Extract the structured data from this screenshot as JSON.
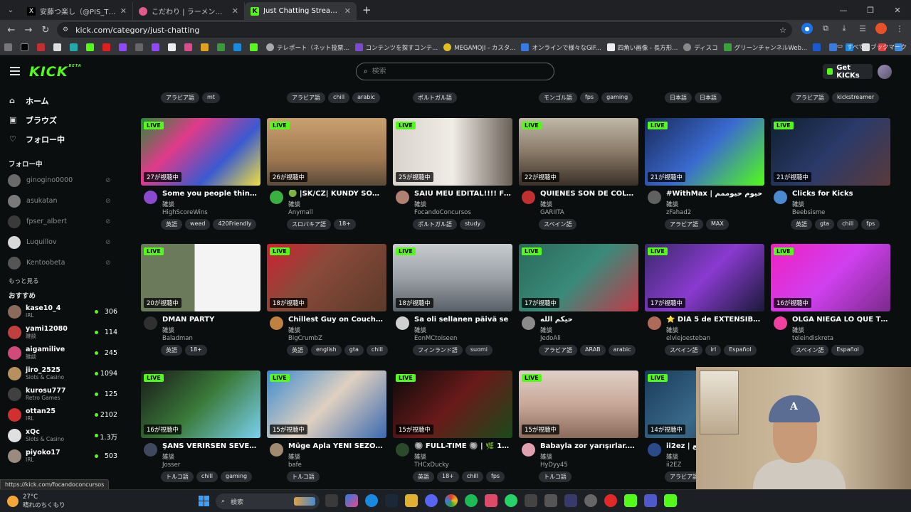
{
  "browser": {
    "tabs": [
      {
        "title": "安藤つ楽し（@PIS_TSUYOSHI）",
        "favicon": "x-icon",
        "active": false
      },
      {
        "title": "こだわり | ラーメン豚山",
        "favicon": "pig-icon",
        "active": false
      },
      {
        "title": "Just Chatting Streaming - Live",
        "favicon": "kick-icon",
        "active": true
      }
    ],
    "url": "kick.com/category/just-chatting",
    "bookmarks": [
      "テレポート（ネット投票...",
      "コンテンツを探すコンテ...",
      "MEGAMOJI - カスタ...",
      "オンラインで様々なGIF...",
      "四角い画像 - 長方形...",
      "ディスコ",
      "グリーンチャンネルWeb..."
    ],
    "bookmarks_all": "すべてのブックマーク"
  },
  "header": {
    "logo": "KICK",
    "logo_beta": "BETA",
    "search_placeholder": "検索",
    "get_kicks": "Get KICKs"
  },
  "sidebar": {
    "nav": [
      {
        "label": "ホーム",
        "icon": "home-icon"
      },
      {
        "label": "ブラウズ",
        "icon": "browse-icon"
      },
      {
        "label": "フォロー中",
        "icon": "heart-icon"
      }
    ],
    "following_heading": "フォロー中",
    "following": [
      {
        "name": "ginogino0000",
        "color": "#6a6a6a"
      },
      {
        "name": "asukatan",
        "color": "#7a7a7a"
      },
      {
        "name": "fpser_albert",
        "color": "#3a3a3a"
      },
      {
        "name": "Luquillov",
        "color": "#d8d8d8"
      },
      {
        "name": "Kentoobeta",
        "color": "#555"
      }
    ],
    "more_label": "もっと見る",
    "recommended_heading": "おすすめ",
    "recommended": [
      {
        "name": "kase10_4",
        "category": "IRL",
        "viewers": "306",
        "color": "#8a6a5a"
      },
      {
        "name": "yami12080",
        "category": "雑談",
        "viewers": "114",
        "color": "#c04040"
      },
      {
        "name": "aigamilive",
        "category": "雑談",
        "viewers": "245",
        "color": "#d04a7a"
      },
      {
        "name": "jiro_2525",
        "category": "Slots & Casino",
        "viewers": "1094",
        "color": "#b89060"
      },
      {
        "name": "kurosu777",
        "category": "Retro Games",
        "viewers": "125",
        "color": "#404040"
      },
      {
        "name": "ottan25",
        "category": "IRL",
        "viewers": "2102",
        "color": "#d03030"
      },
      {
        "name": "xQc",
        "category": "Slots & Casino",
        "viewers": "1.3万",
        "color": "#e0e0e0"
      },
      {
        "name": "piyoko17",
        "category": "IRL",
        "viewers": "503",
        "color": "#9a8a80"
      }
    ]
  },
  "partial_row": [
    {
      "tags": [
        "アラビア語",
        "mt"
      ]
    },
    {
      "tags": [
        "アラビア語",
        "chill",
        "arabic"
      ]
    },
    {
      "tags": [
        "ポルトガル語"
      ]
    },
    {
      "tags": [
        "モンゴル語",
        "fps",
        "gaming"
      ]
    },
    {
      "tags": [
        "日本語",
        "日本語"
      ]
    },
    {
      "tags": [
        "アラビア語",
        "kickstreamer"
      ]
    }
  ],
  "streams": [
    {
      "live": "LIVE",
      "viewers": "27が視聴中",
      "title": "Some you people think I'...",
      "category": "雑談",
      "channel": "HighScoreWins",
      "tags": [
        "英語",
        "weed",
        "420Friendly"
      ],
      "thumb": "linear-gradient(135deg,#2a8a3a,#e03a8a,#3a5ad0,#f0e040)",
      "avatar": "#8a4ad0"
    },
    {
      "live": "LIVE",
      "viewers": "26が視聴中",
      "title": "🟢 |SK/CZ| KUNDY SOM ...",
      "category": "雑談",
      "channel": "Anymall",
      "tags": [
        "スロバキア語",
        "18+"
      ],
      "thumb": "linear-gradient(180deg,#c8a070,#a07850 60%,#5a4a3a)",
      "avatar": "#3ab040"
    },
    {
      "live": "LIVE",
      "viewers": "25が視聴中",
      "title": "SAIU MEU EDITAL!!!! Foco...",
      "category": "雑談",
      "channel": "FocandoConcursos",
      "tags": [
        "ポルトガル語",
        "study"
      ],
      "thumb": "linear-gradient(90deg,#d8d4cc,#f0ece6 50%,#6a6058)",
      "avatar": "#b08070"
    },
    {
      "live": "LIVE",
      "viewers": "22が視聴中",
      "title": "QUIENES SON DE COLOM...",
      "category": "雑談",
      "channel": "GARIITA",
      "tags": [
        "スペイン語"
      ],
      "thumb": "linear-gradient(180deg,#c0b8a8,#8a7a68 50%,#3a3028)",
      "avatar": "#c03030"
    },
    {
      "live": "LIVE",
      "viewers": "21が視聴中",
      "title": "#WithMax | حيوم حيوممم",
      "category": "雑談",
      "channel": "zFahad2",
      "tags": [
        "アラビア語",
        "MAX"
      ],
      "thumb": "linear-gradient(135deg,#1a2a5a,#3a6ad0 50%,#53fc18)",
      "avatar": "#606060"
    },
    {
      "live": "LIVE",
      "viewers": "21が視聴中",
      "title": "Clicks for Kicks",
      "category": "雑談",
      "channel": "Beebsisme",
      "tags": [
        "英語",
        "gta",
        "chill",
        "fps"
      ],
      "thumb": "linear-gradient(135deg,#102030,#2a3a6a 50%,#5a3a3a)",
      "avatar": "#4a8ad0"
    },
    {
      "live": "LIVE",
      "viewers": "20が視聴中",
      "title": "DMAN PARTY",
      "category": "雑談",
      "channel": "Baladman",
      "tags": [
        "英語",
        "18+"
      ],
      "thumb": "linear-gradient(90deg,#6a7a5a 45%,#f4f4f4 45%)",
      "avatar": "#303030"
    },
    {
      "live": "LIVE",
      "viewers": "18が視聴中",
      "title": "Chillest Guy on Couch ! V...",
      "category": "雑談",
      "channel": "BigCrumbZ",
      "tags": [
        "英語",
        "english",
        "gta",
        "chill"
      ],
      "thumb": "linear-gradient(135deg,#d02030,#8a4a3a 40%,#5a3a2a)",
      "avatar": "#c08040"
    },
    {
      "live": "LIVE",
      "viewers": "18が視聴中",
      "title": "Sa oli sellanen päivä se",
      "category": "雑談",
      "channel": "EonMCtoiseen",
      "tags": [
        "フィンランド語",
        "suomi"
      ],
      "thumb": "linear-gradient(180deg,#c8ccd0,#9aa0a6 50%,#5a6068)",
      "avatar": "#d0d0d0"
    },
    {
      "live": "LIVE",
      "viewers": "17が視聴中",
      "title": "حيكم الله",
      "category": "雑談",
      "channel": "JedoAli",
      "tags": [
        "アラビア語",
        "ARAB",
        "arabic"
      ],
      "thumb": "linear-gradient(135deg,#2a6a5a,#3a8a7a 50%,#c03a4a)",
      "avatar": "#8a8a8a"
    },
    {
      "live": "LIVE",
      "viewers": "17が視聴中",
      "title": "⭐ DÍA 5 de EXTENSIBLE ...",
      "category": "雑談",
      "channel": "elviejoesteban",
      "tags": [
        "スペイン語",
        "irl",
        "Español"
      ],
      "thumb": "linear-gradient(135deg,#3a2a6a,#8a3ad0 50%,#1a1a3a)",
      "avatar": "#b06a5a"
    },
    {
      "live": "LIVE",
      "viewers": "16が視聴中",
      "title": "OLGA NIEGA LO QUE TOD...",
      "category": "雑談",
      "channel": "teleindiskreta",
      "tags": [
        "スペイン語",
        "Español"
      ],
      "thumb": "linear-gradient(135deg,#f020c0,#d040f0 50%,#7a2a8a)",
      "avatar": "#f040a0"
    },
    {
      "live": "LIVE",
      "viewers": "16が視聴中",
      "title": "ŞANS VERİRSEN SEVERSİ...",
      "category": "雑談",
      "channel": "Josser",
      "tags": [
        "トルコ語",
        "chill",
        "gaming"
      ],
      "thumb": "linear-gradient(135deg,#1a1a1a,#3a7a3a 50%,#7ad0f0)",
      "avatar": "#404860"
    },
    {
      "live": "LIVE",
      "viewers": "15が視聴中",
      "title": "Müge Apla YENİ SEZON Y...",
      "category": "雑談",
      "channel": "bafe",
      "tags": [
        "トルコ語"
      ],
      "thumb": "linear-gradient(135deg,#3a8ad0,#e0d0c0 50%,#3a6ab0)",
      "avatar": "#a08a70"
    },
    {
      "live": "LIVE",
      "viewers": "15が視聴中",
      "title": "🔘 FULL-TIME 🔘 | 🌿 18+ ...",
      "category": "雑談",
      "channel": "THCxDucky",
      "tags": [
        "英語",
        "18+",
        "chill",
        "fps"
      ],
      "thumb": "linear-gradient(135deg,#0a0a0a,#6a1a1a 50%,#1a4a1a)",
      "avatar": "#2a4a2a"
    },
    {
      "live": "LIVE",
      "viewers": "15が視聴中",
      "title": "Babayla zor yarışırlar. ! Ba...",
      "category": "雑談",
      "channel": "HyDyy45",
      "tags": [
        "トルコ語"
      ],
      "thumb": "linear-gradient(180deg,#e0d0c8,#c8a898 50%,#8a6a5a)",
      "avatar": "#e0a0b0"
    },
    {
      "live": "LIVE",
      "viewers": "14が視聴中",
      "title": "ii2ez | ربيع",
      "category": "雑談",
      "channel": "ii2EZ",
      "tags": [
        "アラビア語"
      ],
      "thumb": "linear-gradient(135deg,#1a3a5a,#3a6a8a 50%,#1a2a3a)",
      "avatar": "#2a4a8a"
    }
  ],
  "status_url": "https://kick.com/focandoconcursos",
  "taskbar": {
    "temperature": "27°C",
    "weather": "晴れのちくもり",
    "search": "検索"
  }
}
